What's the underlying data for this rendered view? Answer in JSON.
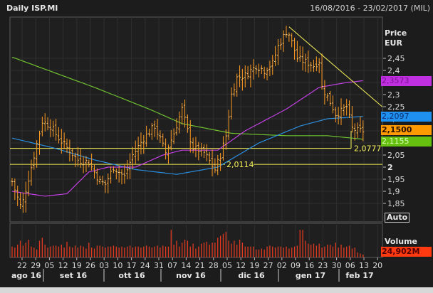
{
  "header": {
    "title": "Daily ISP.MI",
    "range": "16/08/2016 - 23/02/2017 (MIL)"
  },
  "axis": {
    "price_label": "Price",
    "currency": "EUR",
    "auto_label": "Auto",
    "volume_label": "Volume"
  },
  "tags": {
    "sma_magenta": {
      "value": "2,3573",
      "color": "#c030e0",
      "text": "#7a1090"
    },
    "sma_blue": {
      "value": "2,2097",
      "color": "#1e90f0",
      "text": "#103070"
    },
    "last_price": {
      "value": "2,1500",
      "color": "#ff9a00",
      "text": "#2a1000"
    },
    "sma_green": {
      "value": "2,1155",
      "color": "#66c010",
      "text": "#d8ffb0"
    },
    "volume": {
      "value": "24,902M",
      "color": "#ff3a10",
      "text": "#500000"
    }
  },
  "levels": [
    {
      "value": 2.0777,
      "label": "2,0777"
    },
    {
      "value": 2.0114,
      "label": "2,0114"
    }
  ],
  "chart_data": {
    "type": "ohlc",
    "title": "Daily ISP.MI",
    "ylabel": "Price EUR",
    "ylim": [
      1.8,
      2.6
    ],
    "y_ticks": [
      "1,85",
      "1,9",
      "1,95",
      "2",
      "2,05",
      "2,1",
      "2,15",
      "2,2",
      "2,25",
      "2,3",
      "2,35",
      "2,4",
      "2,45"
    ],
    "y_tick_values": [
      1.85,
      1.9,
      1.95,
      2.0,
      2.05,
      2.1,
      2.15,
      2.2,
      2.25,
      2.3,
      2.35,
      2.4,
      2.45
    ],
    "bars": 129,
    "close_anchors": [
      [
        0,
        1.94
      ],
      [
        3,
        1.84
      ],
      [
        4,
        1.86
      ],
      [
        7,
        2.0
      ],
      [
        11,
        2.19
      ],
      [
        14,
        2.17
      ],
      [
        17,
        2.12
      ],
      [
        20,
        2.08
      ],
      [
        24,
        2.03
      ],
      [
        28,
        2.02
      ],
      [
        32,
        1.94
      ],
      [
        34,
        1.93
      ],
      [
        37,
        2.0
      ],
      [
        41,
        1.96
      ],
      [
        44,
        2.05
      ],
      [
        48,
        2.12
      ],
      [
        52,
        2.17
      ],
      [
        56,
        2.06
      ],
      [
        59,
        2.14
      ],
      [
        62,
        2.24
      ],
      [
        64,
        2.15
      ],
      [
        66,
        2.08
      ],
      [
        70,
        2.06
      ],
      [
        74,
        1.99
      ],
      [
        76,
        2.05
      ],
      [
        78,
        2.13
      ],
      [
        80,
        2.3
      ],
      [
        82,
        2.37
      ],
      [
        85,
        2.38
      ],
      [
        89,
        2.42
      ],
      [
        92,
        2.4
      ],
      [
        95,
        2.43
      ],
      [
        97,
        2.5
      ],
      [
        100,
        2.56
      ],
      [
        101,
        2.55
      ],
      [
        104,
        2.45
      ],
      [
        108,
        2.43
      ],
      [
        110,
        2.42
      ],
      [
        112,
        2.44
      ],
      [
        113,
        2.33
      ],
      [
        116,
        2.27
      ],
      [
        118,
        2.22
      ],
      [
        120,
        2.23
      ],
      [
        122,
        2.25
      ],
      [
        124,
        2.16
      ],
      [
        126,
        2.15
      ],
      [
        128,
        2.15
      ]
    ],
    "ma_green": [
      [
        0,
        2.455
      ],
      [
        30,
        2.33
      ],
      [
        50,
        2.24
      ],
      [
        62,
        2.18
      ],
      [
        80,
        2.14
      ],
      [
        100,
        2.13
      ],
      [
        115,
        2.13
      ],
      [
        128,
        2.1155
      ]
    ],
    "ma_blue": [
      [
        0,
        2.12
      ],
      [
        15,
        2.08
      ],
      [
        30,
        2.03
      ],
      [
        45,
        1.99
      ],
      [
        60,
        1.97
      ],
      [
        75,
        2.0
      ],
      [
        90,
        2.1
      ],
      [
        105,
        2.17
      ],
      [
        115,
        2.2
      ],
      [
        128,
        2.2097
      ]
    ],
    "ma_magenta": [
      [
        0,
        1.9
      ],
      [
        12,
        1.88
      ],
      [
        20,
        1.89
      ],
      [
        28,
        1.98
      ],
      [
        35,
        2.0
      ],
      [
        45,
        2.0
      ],
      [
        55,
        2.05
      ],
      [
        62,
        2.07
      ],
      [
        75,
        2.07
      ],
      [
        85,
        2.15
      ],
      [
        100,
        2.24
      ],
      [
        112,
        2.33
      ],
      [
        122,
        2.35
      ],
      [
        128,
        2.3573
      ]
    ],
    "trendline": [
      [
        101,
        2.58
      ],
      [
        135,
        2.25
      ]
    ],
    "volume_millions": [
      22,
      20,
      26,
      34,
      24,
      30,
      36,
      22,
      20,
      16,
      34,
      40,
      26,
      20,
      22,
      24,
      24,
      22,
      26,
      20,
      32,
      22,
      20,
      24,
      20,
      24,
      22,
      18,
      30,
      20,
      18,
      24,
      24,
      22,
      20,
      22,
      22,
      24,
      22,
      20,
      22,
      20,
      22,
      24,
      20,
      22,
      22,
      20,
      22,
      24,
      22,
      20,
      22,
      24,
      20,
      24,
      22,
      22,
      56,
      26,
      34,
      22,
      30,
      36,
      34,
      22,
      28,
      18,
      22,
      28,
      30,
      32,
      26,
      30,
      30,
      40,
      44,
      48,
      52,
      34,
      28,
      34,
      26,
      36,
      30,
      22,
      22,
      22,
      22,
      16,
      16,
      18,
      16,
      22,
      24,
      22,
      20,
      22,
      22,
      20,
      22,
      18,
      20,
      22,
      24,
      56,
      56,
      34,
      28,
      26,
      28,
      24,
      28,
      20,
      22,
      26,
      26,
      22,
      30,
      20,
      26,
      20,
      22,
      24,
      18,
      20,
      10,
      8,
      6
    ],
    "x_day_labels": [
      "22",
      "29",
      "05",
      "12",
      "19",
      "26",
      "03",
      "10",
      "17",
      "24",
      "31",
      "07",
      "14",
      "21",
      "28",
      "05",
      "12",
      "19",
      "27",
      "02",
      "09",
      "16",
      "23",
      "30",
      "06",
      "13",
      "20"
    ],
    "x_month_labels": [
      "ago 16",
      "set 16",
      "ott 16",
      "nov 16",
      "dic 16",
      "gen 17",
      "feb 17"
    ]
  }
}
